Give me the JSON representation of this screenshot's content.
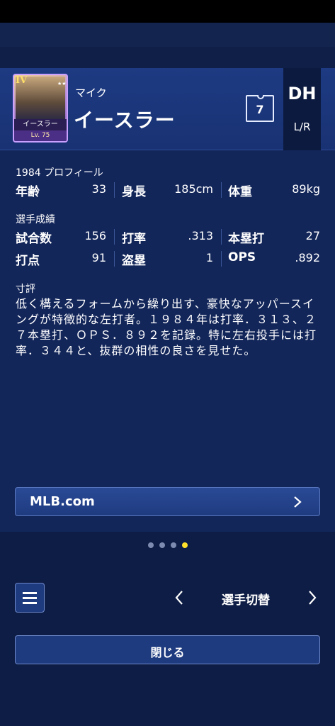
{
  "colors": {
    "background": "#0e1d45",
    "header_bg": "#1b3678",
    "panel_bg": "#13265a",
    "button_bg": "#1f3b80",
    "accent_dot": "#ffe12b",
    "card_border": "#c9a0ff"
  },
  "player": {
    "card": {
      "rank": "IV",
      "stars": "★★★★★★★",
      "name": "イースラー",
      "level": "Lv. 75"
    },
    "first_name": "マイク",
    "last_name": "イースラー",
    "number": "7",
    "position": "DH",
    "bats_throws": "L/R"
  },
  "profile": {
    "title": "1984 プロフィール",
    "stats": [
      {
        "label": "年齢",
        "value": "33"
      },
      {
        "label": "身長",
        "value": "185cm"
      },
      {
        "label": "体重",
        "value": "89kg"
      }
    ]
  },
  "record": {
    "title": "選手成績",
    "rows": [
      [
        {
          "label": "試合数",
          "value": "156"
        },
        {
          "label": "打率",
          "value": ".313"
        },
        {
          "label": "本塁打",
          "value": "27"
        }
      ],
      [
        {
          "label": "打点",
          "value": "91"
        },
        {
          "label": "盗塁",
          "value": "1"
        },
        {
          "label": "OPS",
          "value": ".892"
        }
      ]
    ]
  },
  "review": {
    "title": "寸評",
    "text": "低く構えるフォームから繰り出す、豪快なアッパースイングが特徴的な左打者。１９８４年は打率．３１３、２７本塁打、ＯＰＳ．８９２を記録。特に左右投手には打率．３４４と、抜群の相性の良さを見せた。"
  },
  "links": {
    "mlb_label": "MLB.com"
  },
  "pagination": {
    "total": 4,
    "active_index": 3
  },
  "footer": {
    "menu_icon": "hamburger-menu-icon",
    "prev_icon": "chevron-left-icon",
    "next_icon": "chevron-right-icon",
    "switch_label": "選手切替",
    "close_label": "閉じる"
  }
}
